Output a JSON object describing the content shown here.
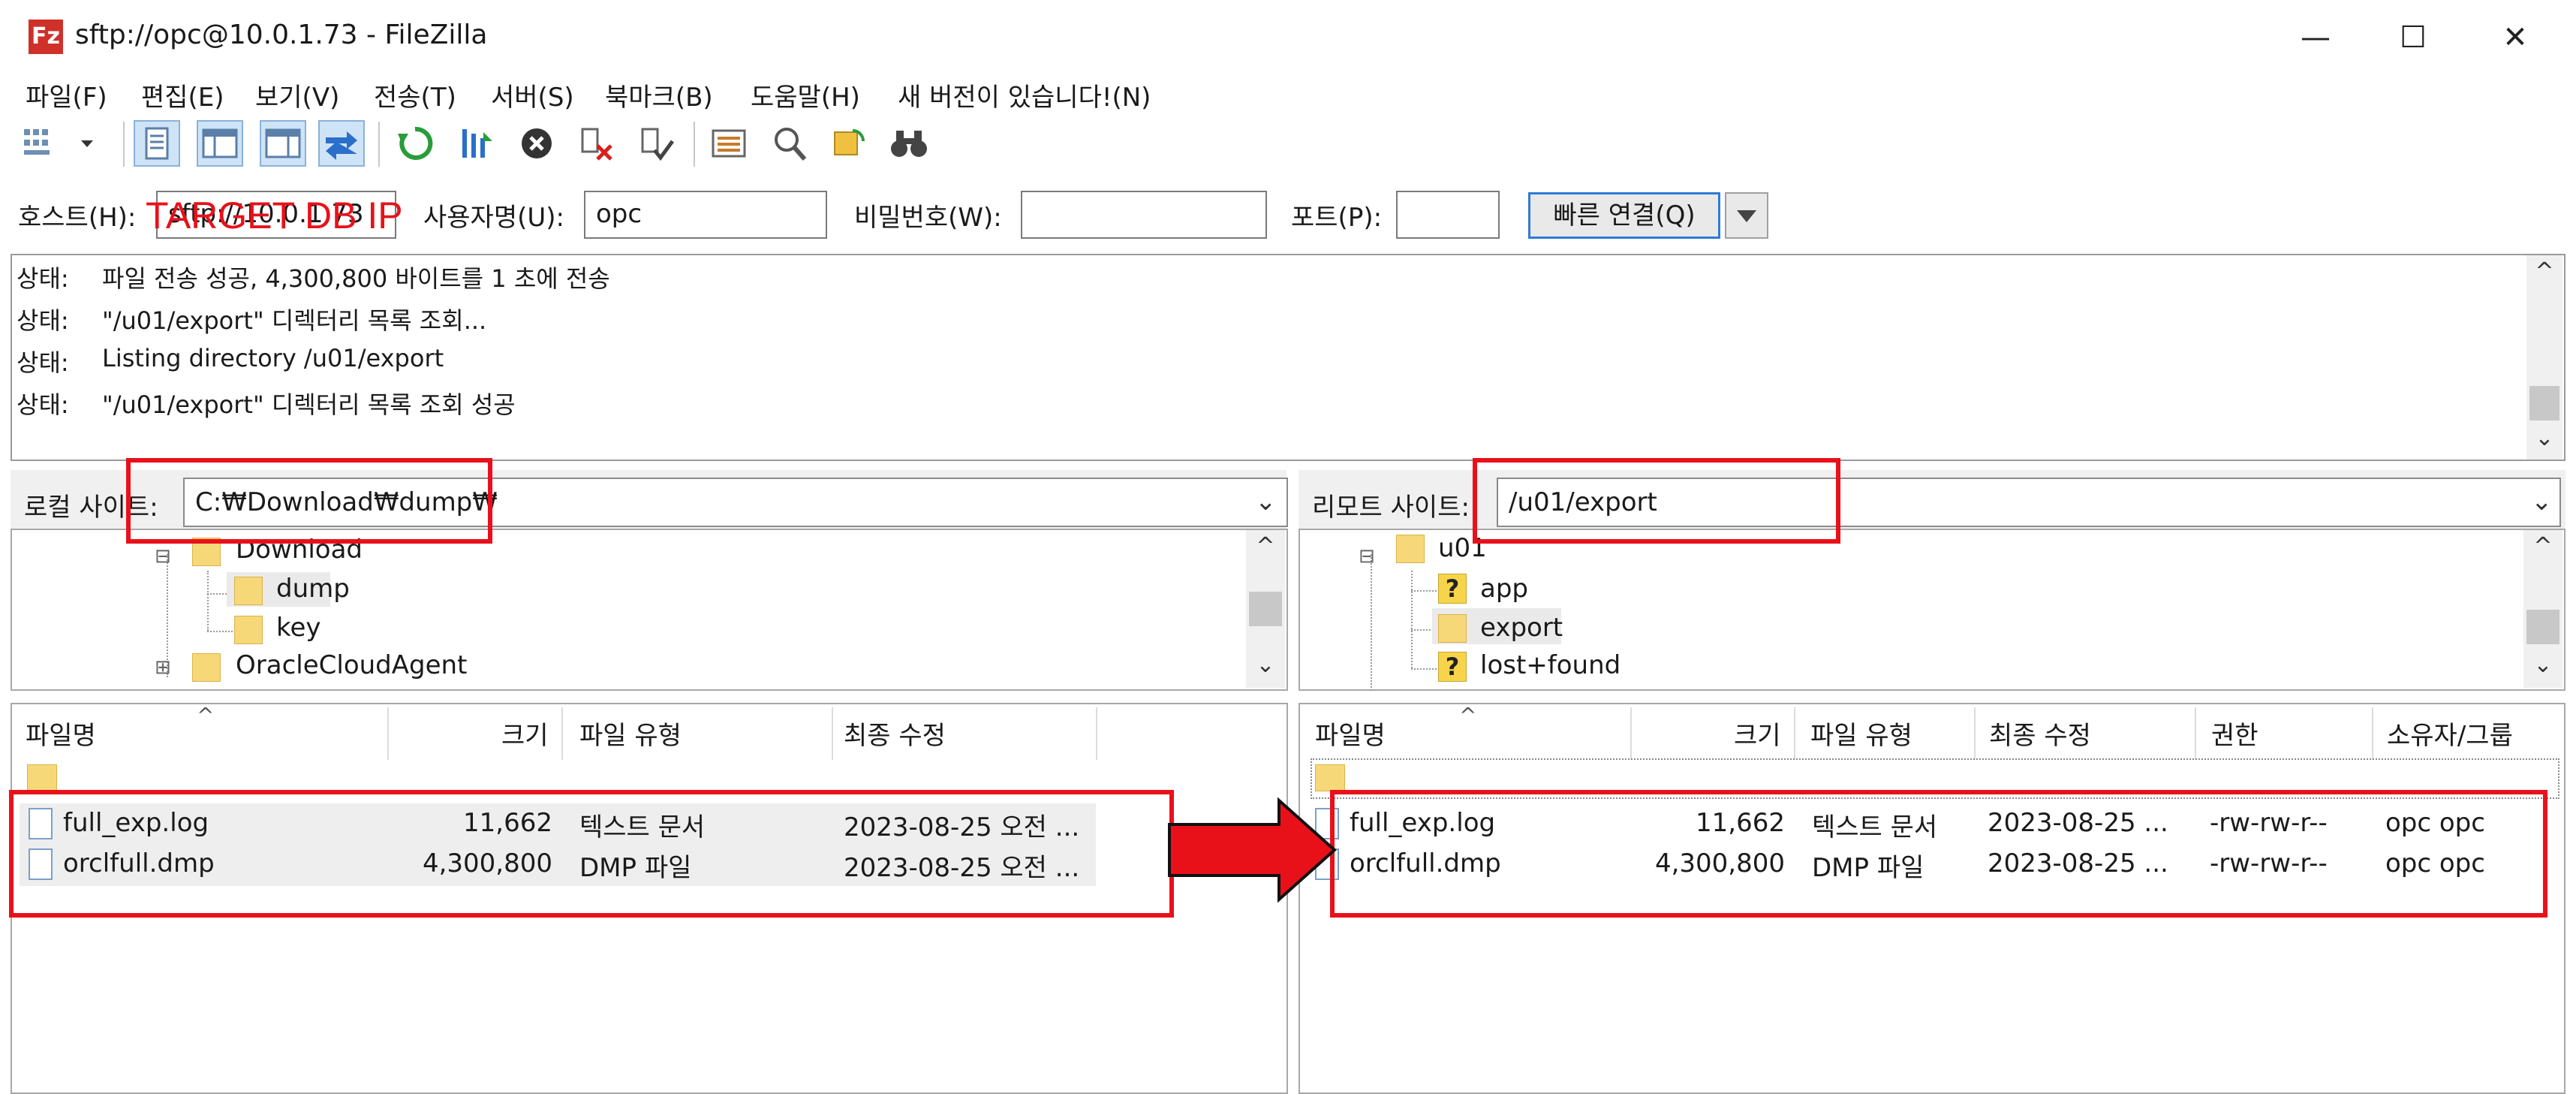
{
  "window": {
    "title": "sftp://opc@10.0.1.73 - FileZilla",
    "app_icon_letter": "Fz",
    "minimize": "—",
    "maximize": "☐",
    "close": "✕"
  },
  "menu": [
    "파일(F)",
    "편집(E)",
    "보기(V)",
    "전송(T)",
    "서버(S)",
    "북마크(B)",
    "도움말(H)",
    "새 버전이 있습니다!(N)"
  ],
  "quickconnect": {
    "host_label": "호스트(H):",
    "host_value": "sftp://10.0.1.73",
    "user_label": "사용자명(U):",
    "user_value": "opc",
    "pass_label": "비밀번호(W):",
    "pass_value": "",
    "port_label": "포트(P):",
    "port_value": "",
    "connect_button": "빠른 연결(Q)",
    "annotation": "TARGET DB IP"
  },
  "log": [
    {
      "label": "상태:",
      "text": "파일 전송 성공, 4,300,800 바이트를 1 초에 전송"
    },
    {
      "label": "상태:",
      "text": "\"/u01/export\" 디렉터리 목록 조회..."
    },
    {
      "label": "상태:",
      "text": "Listing directory /u01/export"
    },
    {
      "label": "상태:",
      "text": "\"/u01/export\" 디렉터리 목록 조회 성공"
    }
  ],
  "local": {
    "site_label": "로컬 사이트:",
    "path": "C:₩Download₩dump₩",
    "tree": [
      {
        "name": "Download",
        "level": 0,
        "expander": "⊟"
      },
      {
        "name": "dump",
        "level": 1
      },
      {
        "name": "key",
        "level": 1
      },
      {
        "name": "OracleCloudAgent",
        "level": 0,
        "expander": "⊞"
      }
    ],
    "columns": [
      "파일명",
      "크기",
      "파일 유형",
      "최종 수정"
    ],
    "files": [
      {
        "name": "full_exp.log",
        "size": "11,662",
        "type": "텍스트 문서",
        "modified": "2023-08-25 오전 ..."
      },
      {
        "name": "orclfull.dmp",
        "size": "4,300,800",
        "type": "DMP 파일",
        "modified": "2023-08-25 오전 ..."
      }
    ]
  },
  "remote": {
    "site_label": "리모트 사이트:",
    "path": "/u01/export",
    "tree": [
      {
        "name": "u01",
        "level": 0,
        "expander": "⊟",
        "icon": "folder"
      },
      {
        "name": "app",
        "level": 1,
        "icon": "question"
      },
      {
        "name": "export",
        "level": 1,
        "icon": "folder"
      },
      {
        "name": "lost+found",
        "level": 1,
        "icon": "question"
      }
    ],
    "columns": [
      "파일명",
      "크기",
      "파일 유형",
      "최종 수정",
      "권한",
      "소유자/그룹"
    ],
    "files": [
      {
        "name": "full_exp.log",
        "size": "11,662",
        "type": "텍스트 문서",
        "modified": "2023-08-25 ...",
        "perm": "-rw-rw-r--",
        "owner": "opc opc"
      },
      {
        "name": "orclfull.dmp",
        "size": "4,300,800",
        "type": "DMP 파일",
        "modified": "2023-08-25 ...",
        "perm": "-rw-rw-r--",
        "owner": "opc opc"
      }
    ]
  },
  "colors": {
    "annotation_red": "#e8111a",
    "folder_yellow": "#f7d878",
    "accent_blue": "#2f7bd6"
  }
}
